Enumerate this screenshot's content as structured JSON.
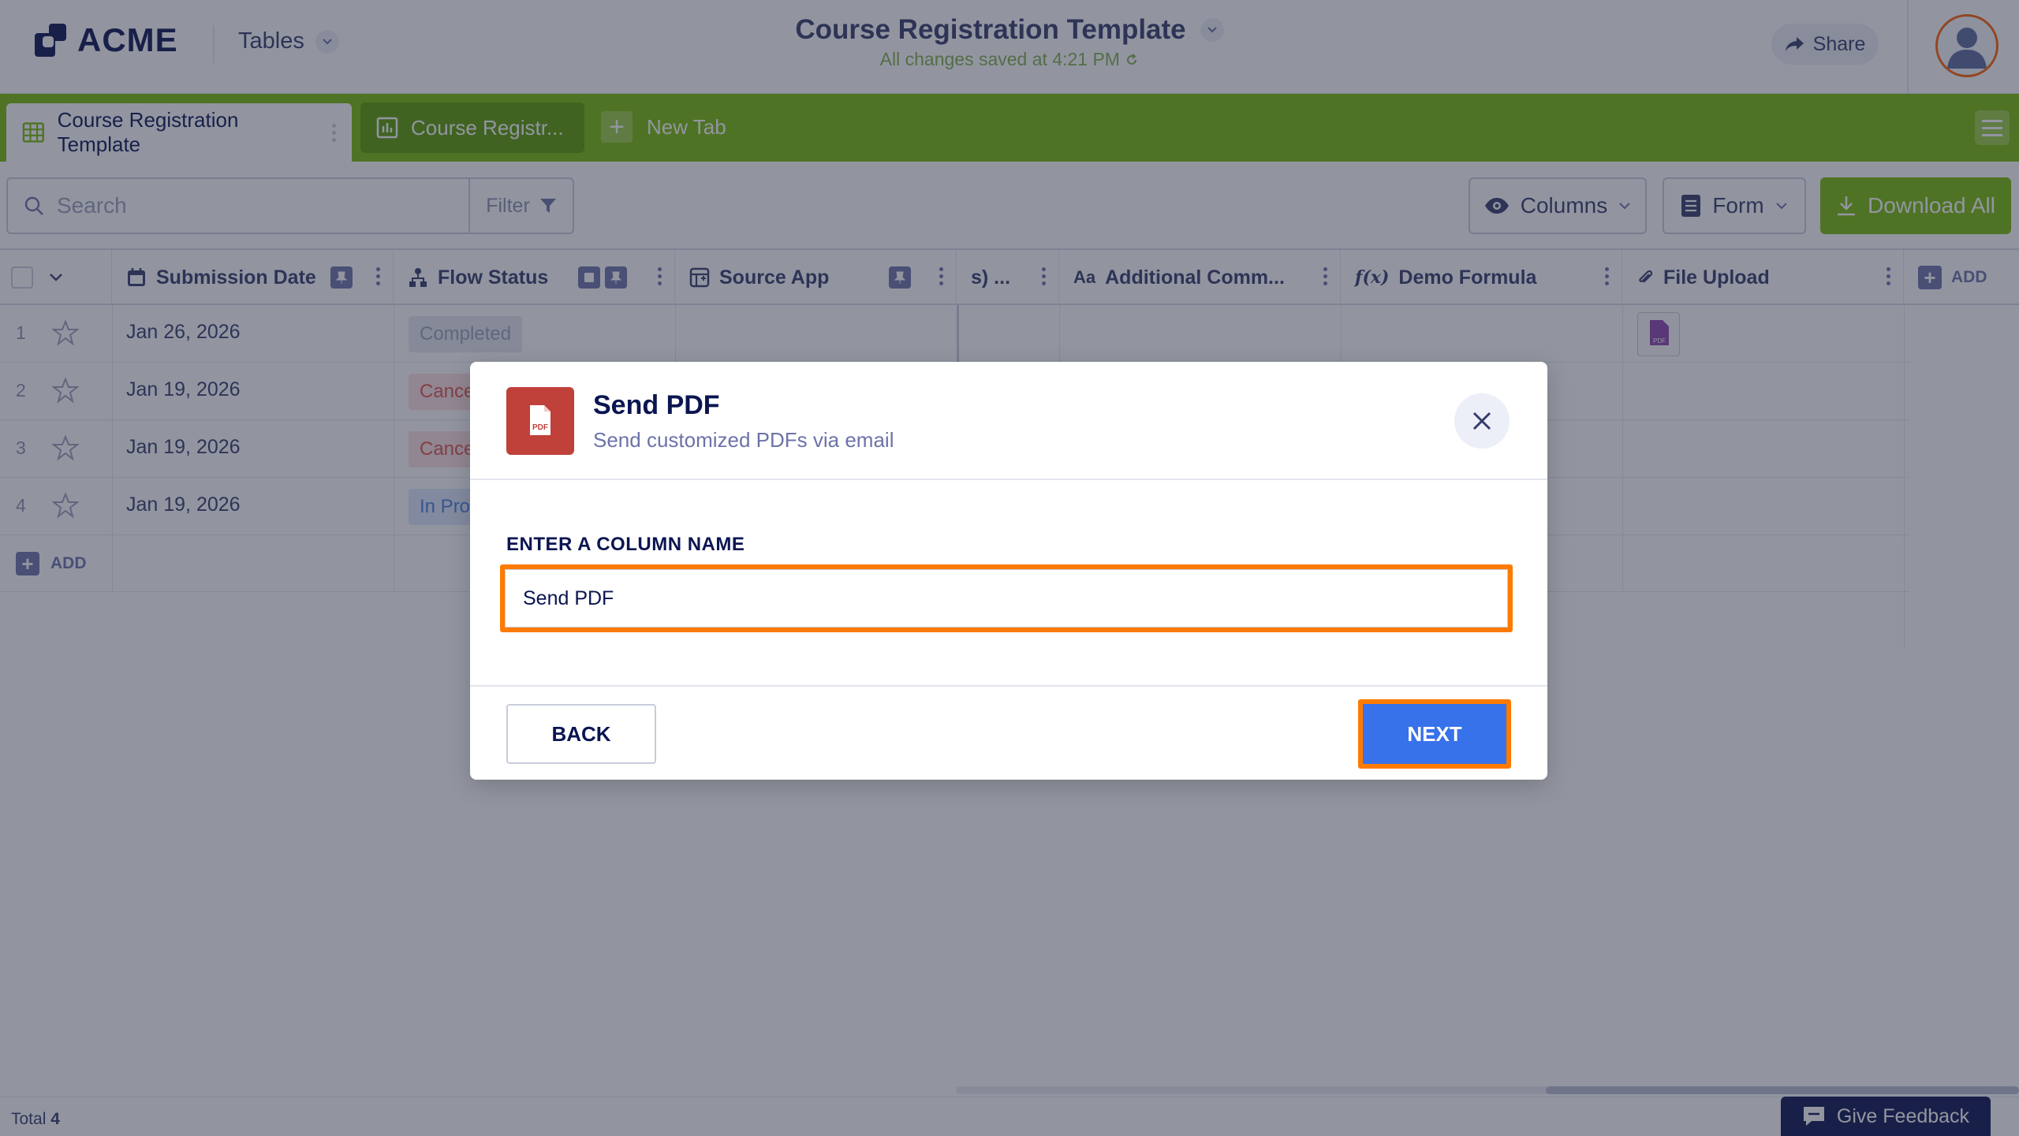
{
  "header": {
    "logo_text": "ACME",
    "tables_label": "Tables",
    "title": "Course Registration Template",
    "saved_status": "All changes saved at 4:21 PM",
    "share_label": "Share"
  },
  "tabs": {
    "active_label": "Course Registration Template",
    "second_label": "Course Registr...",
    "new_tab_label": "New Tab"
  },
  "toolbar": {
    "search_placeholder": "Search",
    "filter_label": "Filter",
    "columns_label": "Columns",
    "form_label": "Form",
    "download_label": "Download All"
  },
  "columns": {
    "submission_date": "Submission Date",
    "flow_status": "Flow Status",
    "source_app": "Source App",
    "truncated": "s) ...",
    "additional_comments": "Additional Comm...",
    "demo_formula": "Demo Formula",
    "file_upload": "File Upload",
    "add_label": "ADD"
  },
  "rows": [
    {
      "num": "1",
      "date": "Jan 26, 2026",
      "status": "Completed"
    },
    {
      "num": "2",
      "date": "Jan 19, 2026",
      "status": "Cance"
    },
    {
      "num": "3",
      "date": "Jan 19, 2026",
      "status": "Cance"
    },
    {
      "num": "4",
      "date": "Jan 19, 2026",
      "status": "In Pro"
    }
  ],
  "add_row_label": "ADD",
  "footer": {
    "total_label": "Total",
    "total_value": "4",
    "feedback_label": "Give Feedback"
  },
  "modal": {
    "title": "Send PDF",
    "subtitle": "Send customized PDFs via email",
    "field_label": "ENTER A COLUMN NAME",
    "field_value": "Send PDF",
    "back_label": "BACK",
    "next_label": "NEXT"
  },
  "colors": {
    "tab_green": "#78bb07",
    "navy": "#0a1551",
    "accent_orange": "#ff7a00",
    "next_blue": "#3872ea",
    "pdf_red": "#c0403a"
  }
}
